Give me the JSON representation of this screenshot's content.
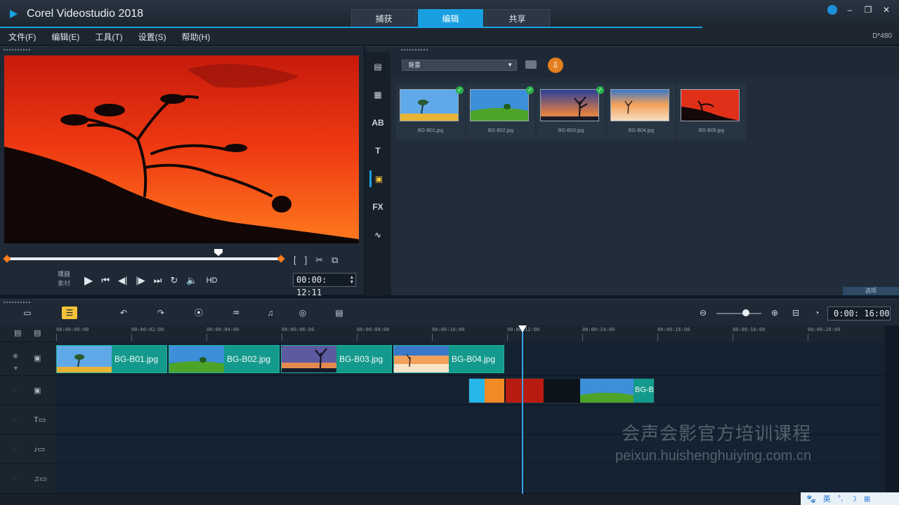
{
  "app": {
    "title": "Corel Videostudio 2018",
    "resolution": "D*480"
  },
  "tabs": [
    {
      "label": "捕获",
      "active": false
    },
    {
      "label": "编辑",
      "active": true
    },
    {
      "label": "共享",
      "active": false
    }
  ],
  "menu": [
    "文件(F)",
    "编辑(E)",
    "工具(T)",
    "设置(S)",
    "帮助(H)"
  ],
  "preview": {
    "mode_project": "项目",
    "mode_clip": "素材",
    "hd": "HD",
    "timecode": "00:00: 12:11",
    "scrub_position": 0.77
  },
  "library": {
    "category": "背景",
    "footer": "选项",
    "thumbnails": [
      {
        "label": "BG-B01.jpg",
        "checked": true
      },
      {
        "label": "BG-B02.jpg",
        "checked": true
      },
      {
        "label": "BG-B03.jpg",
        "checked": true
      },
      {
        "label": "BG-B04.jpg",
        "checked": false
      },
      {
        "label": "BG-B05.jpg",
        "checked": false
      }
    ]
  },
  "timeline": {
    "timecode": "0:00: 16:00",
    "ruler": [
      "00:00:00:00",
      "00:00:02:00",
      "00:00:04:00",
      "00:00:06:00",
      "00:00:08:00",
      "00:00:10:00",
      "00:00:12:00",
      "00:00:14:00",
      "00:00:16:00",
      "00:00:18:00",
      "00:00:20:00"
    ],
    "video_clips": [
      "BG-B01.jpg",
      "BG-B02.jpg",
      "BG-B03.jpg",
      "BG-B04.jpg"
    ],
    "overlay_clip_label": "BG-B"
  },
  "watermark": {
    "title": "会声会影官方培训课程",
    "url": "peixun.huishenghuiying.com.cn"
  },
  "tray": [
    "英",
    "°,",
    "☽",
    "⊞"
  ],
  "colors": {
    "accent": "#1aa0e0",
    "clip": "#149a8c",
    "highlight": "#f2c338"
  }
}
